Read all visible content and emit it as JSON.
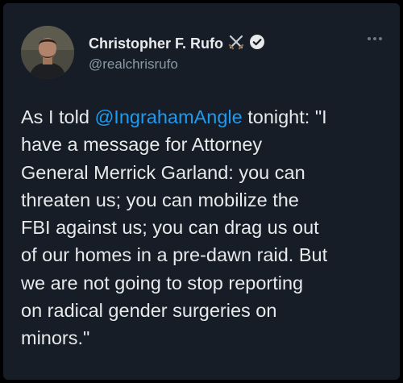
{
  "author": {
    "name": "Christopher F. Rufo",
    "handle": "@realchrisrufo",
    "name_emoji_icon": "crossed-swords-icon",
    "verified_icon": "verified-badge-icon",
    "avatar_icon": "profile-photo"
  },
  "menu_icon": "more-options-icon",
  "tweet": {
    "lines": [
      {
        "before": "As I told ",
        "mention": "@IngrahamAngle",
        "after": " tonight: \"I"
      },
      {
        "text": "have a message for Attorney"
      },
      {
        "text": "General Merrick Garland: you can"
      },
      {
        "text": "threaten us; you can mobilize the"
      },
      {
        "text": "FBI against us; you can drag us out"
      },
      {
        "text": "of our homes in a pre-dawn raid. But"
      },
      {
        "text": "we are not going to stop reporting"
      },
      {
        "text": "on radical gender surgeries on"
      },
      {
        "text": "minors.\""
      }
    ]
  },
  "colors": {
    "background": "#161d27",
    "text": "#e7e9ea",
    "secondary": "#8b98a5",
    "link": "#1d9bf0"
  }
}
